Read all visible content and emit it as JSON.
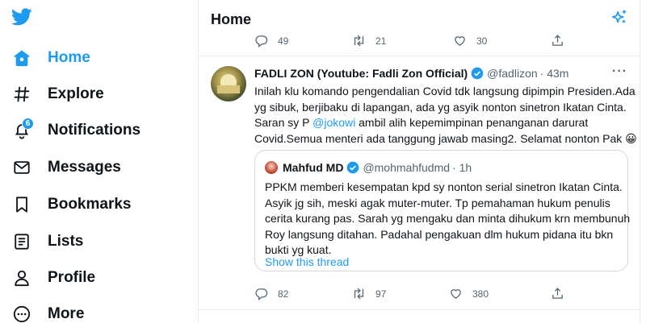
{
  "nav": {
    "items": [
      {
        "label": "Home",
        "icon": "home-icon"
      },
      {
        "label": "Explore",
        "icon": "hashtag-icon"
      },
      {
        "label": "Notifications",
        "icon": "bell-icon",
        "badge": "6"
      },
      {
        "label": "Messages",
        "icon": "envelope-icon"
      },
      {
        "label": "Bookmarks",
        "icon": "bookmark-icon"
      },
      {
        "label": "Lists",
        "icon": "list-icon"
      },
      {
        "label": "Profile",
        "icon": "person-icon"
      },
      {
        "label": "More",
        "icon": "more-circle-icon"
      }
    ]
  },
  "header": {
    "title": "Home"
  },
  "previous_tweet": {
    "replies": "49",
    "retweets": "21",
    "likes": "30"
  },
  "tweet": {
    "name": "FADLI ZON (Youtube: Fadli Zon Official)",
    "handle": "@fadlizon",
    "time": "· 43m",
    "text_lines": [
      "Inilah klu komando pengendalian Covid tdk langsung dipimpin Presiden.Ada",
      "yg sibuk, berjibaku di lapangan, ada yg asyik nonton sinetron Ikatan Cinta.",
      "Saran sy P",
      "ambil alih kepemimpinan penanganan darurat",
      "Covid.Semua menteri ada tanggung jawab masing2. Selamat nonton Pak 😀"
    ],
    "mention": "@jokowi",
    "replies": "82",
    "retweets": "97",
    "likes": "380"
  },
  "quote": {
    "name": "Mahfud MD",
    "handle": "@mohmahfudmd",
    "time": "· 1h",
    "text_lines": [
      "PPKM memberi kesempatan kpd sy nonton serial sinetron Ikatan Cinta.",
      "Asyik jg sih, meski agak muter-muter. Tp pemahaman hukum penulis",
      "cerita kurang pas. Sarah yg mengaku dan minta dihukum krn membunuh",
      "Roy langsung ditahan. Padahal pengakuan dlm hukum pidana itu bkn",
      "bukti yg kuat."
    ],
    "show_thread": "Show this thread"
  },
  "colors": {
    "accent": "#1d9bf0",
    "text": "#0f1419",
    "muted": "#536471",
    "border": "#cfd9de"
  }
}
